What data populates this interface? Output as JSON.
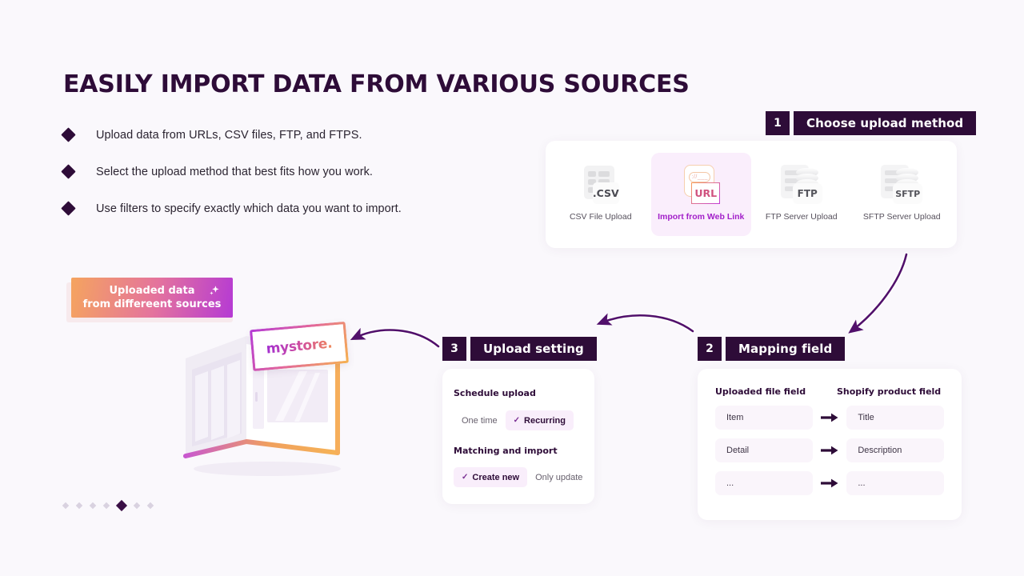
{
  "page": {
    "title": "EASILY IMPORT DATA FROM VARIOUS SOURCES",
    "background_color": "#faf8fc",
    "accent_dark": "#2e0c38",
    "accent_purple": "#a21fc9"
  },
  "bullets": [
    {
      "text": "Upload data from URLs, CSV files, FTP, and FTPS."
    },
    {
      "text": "Select the upload method that best fits how you work."
    },
    {
      "text": "Use filters to specify exactly which data you want to import."
    }
  ],
  "pager": {
    "total": 7,
    "active_index": 5
  },
  "steps": {
    "one": {
      "number": "1",
      "title": "Choose upload method"
    },
    "two": {
      "number": "2",
      "title": "Mapping field"
    },
    "three": {
      "number": "3",
      "title": "Upload setting"
    }
  },
  "upload_methods": [
    {
      "label": "CSV File Upload",
      "icon": "csv-file-icon",
      "badge": ".CSV",
      "selected": false
    },
    {
      "label": "Import from Web Link",
      "icon": "url-link-icon",
      "badge": "URL",
      "address_bar": "://___",
      "selected": true
    },
    {
      "label": "FTP Server Upload",
      "icon": "ftp-server-icon",
      "badge": "FTP",
      "selected": false
    },
    {
      "label": "SFTP Server Upload",
      "icon": "sftp-server-icon",
      "badge": "SFTP",
      "selected": false
    }
  ],
  "mapping": {
    "header_left": "Uploaded file field",
    "header_right": "Shopify product field",
    "rows": [
      {
        "source": "Item",
        "target": "Title"
      },
      {
        "source": "Detail",
        "target": "Description"
      },
      {
        "source": "...",
        "target": "..."
      }
    ]
  },
  "upload_setting": {
    "schedule_heading": "Schedule upload",
    "schedule_options": [
      {
        "label": "One time",
        "selected": false
      },
      {
        "label": "Recurring",
        "selected": true
      }
    ],
    "matching_heading": "Matching and import",
    "matching_options": [
      {
        "label": "Create new",
        "selected": true
      },
      {
        "label": "Only update",
        "selected": false
      }
    ]
  },
  "uploaded_badge": {
    "line1": "Uploaded data",
    "line2": "from differeent sources",
    "gradient_from": "#f5a45f",
    "gradient_to": "#b53ad4"
  },
  "store": {
    "sign_text": "mystore."
  }
}
